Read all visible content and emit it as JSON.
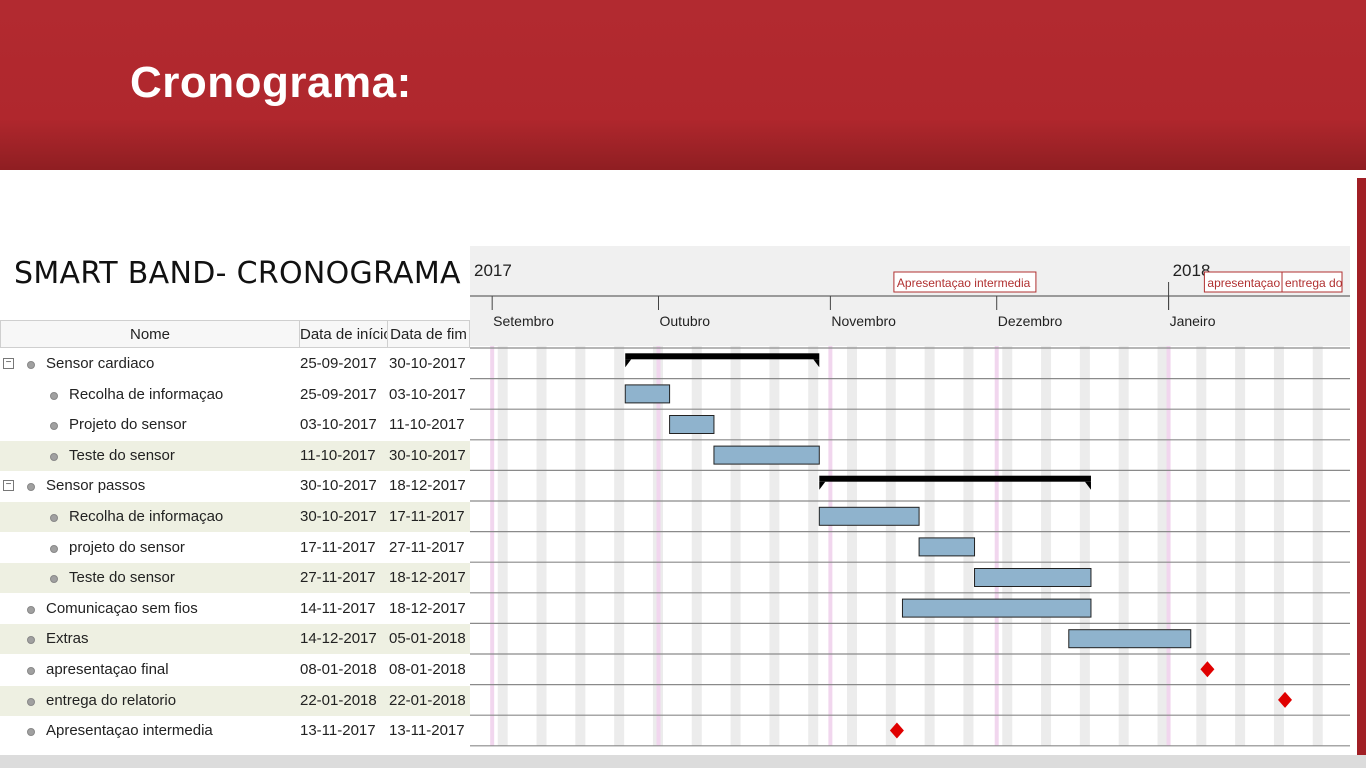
{
  "slide_title": "Cronograma:",
  "band_title": "SMART BAND- CRONOGRAMA",
  "columns": [
    "Nome",
    "Data de início",
    "Data de fim"
  ],
  "tasks": [
    {
      "name": "Sensor cardiaco",
      "start": "25-09-2017",
      "end": "30-10-2017",
      "level": 0,
      "type": "summary"
    },
    {
      "name": "Recolha de informaçao",
      "start": "25-09-2017",
      "end": "03-10-2017",
      "level": 1,
      "type": "task"
    },
    {
      "name": "Projeto do sensor",
      "start": "03-10-2017",
      "end": "11-10-2017",
      "level": 1,
      "type": "task"
    },
    {
      "name": "Teste do sensor",
      "start": "11-10-2017",
      "end": "30-10-2017",
      "level": 1,
      "type": "task"
    },
    {
      "name": "Sensor passos",
      "start": "30-10-2017",
      "end": "18-12-2017",
      "level": 0,
      "type": "summary"
    },
    {
      "name": "Recolha de informaçao",
      "start": "30-10-2017",
      "end": "17-11-2017",
      "level": 1,
      "type": "task"
    },
    {
      "name": "projeto do sensor",
      "start": "17-11-2017",
      "end": "27-11-2017",
      "level": 1,
      "type": "task"
    },
    {
      "name": "Teste do sensor",
      "start": "27-11-2017",
      "end": "18-12-2017",
      "level": 1,
      "type": "task"
    },
    {
      "name": "Comunicaçao sem fios",
      "start": "14-11-2017",
      "end": "18-12-2017",
      "level": 0,
      "type": "task"
    },
    {
      "name": "Extras",
      "start": "14-12-2017",
      "end": "05-01-2018",
      "level": 0,
      "type": "task"
    },
    {
      "name": "apresentaçao final",
      "start": "08-01-2018",
      "end": "08-01-2018",
      "level": 0,
      "type": "milestone"
    },
    {
      "name": "entrega do relatorio",
      "start": "22-01-2018",
      "end": "22-01-2018",
      "level": 0,
      "type": "milestone"
    },
    {
      "name": "Apresentaçao intermedia",
      "start": "13-11-2017",
      "end": "13-11-2017",
      "level": 0,
      "type": "milestone"
    }
  ],
  "chart_data": {
    "type": "gantt",
    "years": [
      "2017",
      "2018"
    ],
    "months": [
      "Setembro",
      "Outubro",
      "Novembro",
      "Dezembro",
      "Janeiro"
    ],
    "range": [
      "2017-09-01",
      "2018-01-31"
    ],
    "markers": [
      "Apresentaçao intermedia",
      "apresentaçao",
      "entrega do"
    ],
    "bars": [
      {
        "start": "2017-09-25",
        "end": "2017-10-30",
        "kind": "summary"
      },
      {
        "start": "2017-09-25",
        "end": "2017-10-03",
        "kind": "task"
      },
      {
        "start": "2017-10-03",
        "end": "2017-10-11",
        "kind": "task"
      },
      {
        "start": "2017-10-11",
        "end": "2017-10-30",
        "kind": "task"
      },
      {
        "start": "2017-10-30",
        "end": "2017-12-18",
        "kind": "summary"
      },
      {
        "start": "2017-10-30",
        "end": "2017-11-17",
        "kind": "task"
      },
      {
        "start": "2017-11-17",
        "end": "2017-11-27",
        "kind": "task"
      },
      {
        "start": "2017-11-27",
        "end": "2017-12-18",
        "kind": "task"
      },
      {
        "start": "2017-11-14",
        "end": "2017-12-18",
        "kind": "task"
      },
      {
        "start": "2017-12-14",
        "end": "2018-01-05",
        "kind": "task"
      },
      {
        "start": "2018-01-08",
        "end": "2018-01-08",
        "kind": "milestone"
      },
      {
        "start": "2018-01-22",
        "end": "2018-01-22",
        "kind": "milestone"
      },
      {
        "start": "2017-11-13",
        "end": "2017-11-13",
        "kind": "milestone"
      }
    ],
    "colors": {
      "task": "#8fb3cd",
      "summary": "#000000",
      "milestone": "#e00000",
      "marker": "#b03030"
    }
  }
}
